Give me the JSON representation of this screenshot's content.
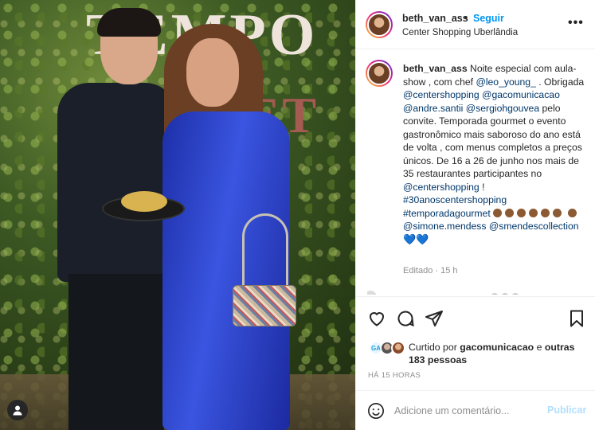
{
  "photo": {
    "sign_line1": "TEMPO",
    "sign_line2": "RMET"
  },
  "header": {
    "username": "beth_van_ass",
    "separator": "•",
    "follow_label": "Seguir",
    "location": "Center Shopping Uberlândia",
    "more_label": "•••"
  },
  "caption": {
    "username": "beth_van_ass",
    "text_1": " Noite especial com aula-show , com chef ",
    "mention_1": "@leo_young_",
    "text_2": " . Obrigada ",
    "mention_2": "@centershopping",
    "mention_3": "@gacomunicacao",
    "mention_4": "@andre.santii",
    "mention_5": "@sergiohgouvea",
    "text_3": " pelo convite. Temporada gourmet o evento gastronômico mais saboroso do ano está de volta , com menus completos a preços únicos. De 16 a 26 de junho nos mais de 35 restaurantes participantes no ",
    "mention_6": "@centershopping",
    "text_4": " ! ",
    "hashtag_1": "#30anoscentershopping",
    "hashtag_2": "#temporadagourmet",
    "mention_7": "@simone.mendess",
    "mention_8": "@smendescollection",
    "hearts": "💙💙",
    "edited": "Editado · 15 h"
  },
  "likes": {
    "prefix": "Curtido por ",
    "user": "gacomunicacao",
    "mid": " e ",
    "others": "outras 183 pessoas"
  },
  "time_ago": "HÁ 15 HORAS",
  "comment_box": {
    "placeholder": "Adicione um comentário...",
    "publish_label": "Publicar"
  },
  "colors": {
    "link": "#00376b",
    "follow": "#0095f6",
    "publish_disabled": "#b2dffc",
    "muted": "#8e8e8e",
    "suit_blue": "#2a3fd0"
  }
}
